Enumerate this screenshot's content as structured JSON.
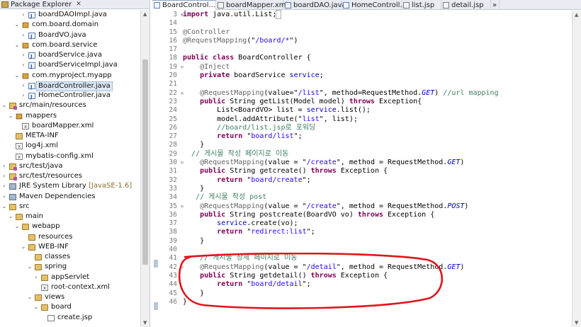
{
  "explorer": {
    "title": "Package Explorer",
    "close": "✕",
    "items": [
      {
        "label": "boardDAOImpl.java",
        "icon": "java-file-icon",
        "indent": 4,
        "twisty": ">"
      },
      {
        "label": "com.board.domain",
        "icon": "package-icon",
        "indent": 3,
        "twisty": "v"
      },
      {
        "label": "BoardVO.java",
        "icon": "java-file-icon",
        "indent": 4,
        "twisty": ">"
      },
      {
        "label": "com.board.service",
        "icon": "package-icon",
        "indent": 3,
        "twisty": "v"
      },
      {
        "label": "boardService.java",
        "icon": "java-file-icon",
        "indent": 4,
        "twisty": ">"
      },
      {
        "label": "boardServiceImpl.java",
        "icon": "java-file-icon",
        "indent": 4,
        "twisty": ">"
      },
      {
        "label": "com.myproject.myapp",
        "icon": "package-icon",
        "indent": 3,
        "twisty": "v"
      },
      {
        "label": "BoardController.java",
        "icon": "java-file-icon",
        "indent": 4,
        "twisty": ">",
        "selected": true
      },
      {
        "label": "HomeController.java",
        "icon": "java-file-icon",
        "indent": 4,
        "twisty": ">"
      },
      {
        "label": "src/main/resources",
        "icon": "source-folder-icon",
        "indent": 1,
        "twisty": "v"
      },
      {
        "label": "mappers",
        "icon": "package-icon",
        "indent": 2,
        "twisty": "v"
      },
      {
        "label": "boardMapper.xml",
        "icon": "xml-file-icon",
        "indent": 3,
        "twisty": ""
      },
      {
        "label": "META-INF",
        "icon": "folder-icon",
        "indent": 2,
        "twisty": ""
      },
      {
        "label": "log4j.xml",
        "icon": "xml-file-icon",
        "indent": 2,
        "twisty": ""
      },
      {
        "label": "mybatis-config.xml",
        "icon": "xml-file-icon",
        "indent": 2,
        "twisty": ""
      },
      {
        "label": "src/test/java",
        "icon": "source-folder-icon",
        "indent": 1,
        "twisty": ">"
      },
      {
        "label": "src/test/resources",
        "icon": "source-folder-icon",
        "indent": 1,
        "twisty": ">"
      },
      {
        "label": "JRE System Library",
        "suffix": " [JavaSE-1.6]",
        "icon": "library-icon",
        "indent": 1,
        "twisty": ">"
      },
      {
        "label": "Maven Dependencies",
        "icon": "library-icon",
        "indent": 1,
        "twisty": ">"
      },
      {
        "label": "src",
        "icon": "folder-icon",
        "indent": 1,
        "twisty": "v"
      },
      {
        "label": "main",
        "icon": "folder-icon",
        "indent": 2,
        "twisty": "v"
      },
      {
        "label": "webapp",
        "icon": "folder-icon",
        "indent": 3,
        "twisty": "v"
      },
      {
        "label": "resources",
        "icon": "folder-icon",
        "indent": 4,
        "twisty": ""
      },
      {
        "label": "WEB-INF",
        "icon": "folder-icon",
        "indent": 4,
        "twisty": "v"
      },
      {
        "label": "classes",
        "icon": "folder-icon",
        "indent": 5,
        "twisty": ""
      },
      {
        "label": "spring",
        "icon": "folder-icon",
        "indent": 5,
        "twisty": "v"
      },
      {
        "label": "appServlet",
        "icon": "folder-icon",
        "indent": 6,
        "twisty": ">"
      },
      {
        "label": "root-context.xml",
        "icon": "xml-file-icon",
        "indent": 6,
        "twisty": ""
      },
      {
        "label": "views",
        "icon": "folder-icon",
        "indent": 5,
        "twisty": "v"
      },
      {
        "label": "board",
        "icon": "folder-icon",
        "indent": 6,
        "twisty": "v"
      },
      {
        "label": "create.jsp",
        "icon": "jsp-file-icon",
        "indent": 7,
        "twisty": ""
      }
    ]
  },
  "editor": {
    "tabs": [
      {
        "label": "BoardControl...",
        "icon": "java-file-icon",
        "active": true,
        "close": "✕"
      },
      {
        "label": "boardMapper.xml",
        "icon": "xml-file-icon",
        "active": false
      },
      {
        "label": "boardDAO.java",
        "icon": "java-file-icon",
        "active": false
      },
      {
        "label": "HomeControll...",
        "icon": "java-file-icon",
        "active": false
      },
      {
        "label": "list.jsp",
        "icon": "jsp-file-icon",
        "active": false
      },
      {
        "label": "detail.jsp",
        "icon": "jsp-file-icon",
        "active": false
      },
      {
        "label": "»",
        "icon": "",
        "active": false
      }
    ],
    "lines": [
      {
        "n": "3",
        "fold": "⊕",
        "parts": [
          [
            "kw",
            "import"
          ],
          [
            "",
            "&nbsp;java.util.List;"
          ],
          [
            "bx",
            "&nbsp;"
          ]
        ]
      },
      {
        "n": "14",
        "parts": []
      },
      {
        "n": "15",
        "parts": [
          [
            "an",
            "@Controller"
          ]
        ]
      },
      {
        "n": "16",
        "parts": [
          [
            "an",
            "@RequestMapping"
          ],
          [
            "",
            "(\""
          ],
          [
            "st",
            "/board/*"
          ],
          [
            "",
            "\")"
          ]
        ]
      },
      {
        "n": "17",
        "parts": []
      },
      {
        "n": "18",
        "parts": [
          [
            "kw",
            "public"
          ],
          [
            "",
            "&nbsp;"
          ],
          [
            "kw",
            "class"
          ],
          [
            "",
            "&nbsp;BoardController&nbsp;{"
          ]
        ]
      },
      {
        "n": "19",
        "fold": "⊖",
        "parts": [
          [
            "",
            "&nbsp;&nbsp;&nbsp;&nbsp;"
          ],
          [
            "an",
            "@Inject"
          ]
        ]
      },
      {
        "n": "20",
        "parts": [
          [
            "",
            "&nbsp;&nbsp;&nbsp;&nbsp;"
          ],
          [
            "kw",
            "private"
          ],
          [
            "",
            "&nbsp;boardService&nbsp;"
          ],
          [
            "fd",
            "service"
          ],
          [
            "",
            ";"
          ]
        ]
      },
      {
        "n": "21",
        "parts": []
      },
      {
        "n": "22",
        "fold": "⊖",
        "parts": [
          [
            "",
            "&nbsp;&nbsp;&nbsp;&nbsp;"
          ],
          [
            "an",
            "@RequestMapping"
          ],
          [
            "",
            "(value=\""
          ],
          [
            "st",
            "/list"
          ],
          [
            "",
            "\",&nbsp;method=RequestMethod."
          ],
          [
            "fd it",
            "GET"
          ],
          [
            "",
            ")&nbsp;"
          ],
          [
            "cm",
            "//url&nbsp;mapping"
          ]
        ]
      },
      {
        "n": "23",
        "parts": [
          [
            "",
            "&nbsp;&nbsp;&nbsp;&nbsp;"
          ],
          [
            "kw",
            "public"
          ],
          [
            "",
            "&nbsp;String&nbsp;getList(Model&nbsp;model)&nbsp;"
          ],
          [
            "kw",
            "throws"
          ],
          [
            "",
            "&nbsp;Exception{"
          ]
        ]
      },
      {
        "n": "24",
        "parts": [
          [
            "",
            "&nbsp;&nbsp;&nbsp;&nbsp;&nbsp;&nbsp;&nbsp;&nbsp;List&lt;BoardVO&gt;&nbsp;list&nbsp;=&nbsp;"
          ],
          [
            "fd",
            "service"
          ],
          [
            "",
            ".list();"
          ]
        ]
      },
      {
        "n": "25",
        "parts": [
          [
            "",
            "&nbsp;&nbsp;&nbsp;&nbsp;&nbsp;&nbsp;&nbsp;&nbsp;model.addAttribute(\""
          ],
          [
            "st",
            "list"
          ],
          [
            "",
            "\",&nbsp;list);"
          ]
        ]
      },
      {
        "n": "26",
        "parts": [
          [
            "",
            "&nbsp;&nbsp;&nbsp;&nbsp;&nbsp;&nbsp;&nbsp;&nbsp;"
          ],
          [
            "cm",
            "//board/list.jsp로&nbsp;포워딩"
          ]
        ]
      },
      {
        "n": "27",
        "parts": [
          [
            "",
            "&nbsp;&nbsp;&nbsp;&nbsp;&nbsp;&nbsp;&nbsp;&nbsp;"
          ],
          [
            "kw",
            "return"
          ],
          [
            "",
            "&nbsp;\""
          ],
          [
            "st",
            "board/list"
          ],
          [
            "",
            "\";"
          ]
        ]
      },
      {
        "n": "28",
        "parts": [
          [
            "",
            "&nbsp;&nbsp;&nbsp;&nbsp;}"
          ]
        ]
      },
      {
        "n": "29",
        "parts": [
          [
            "",
            "&nbsp;&nbsp;"
          ],
          [
            "cm",
            "//&nbsp;게시물&nbsp;작성&nbsp;페이지로&nbsp;이동"
          ]
        ]
      },
      {
        "n": "30",
        "fold": "⊖",
        "parts": [
          [
            "",
            "&nbsp;&nbsp;&nbsp;&nbsp;"
          ],
          [
            "an",
            "@RequestMapping"
          ],
          [
            "",
            "(value&nbsp;=&nbsp;\""
          ],
          [
            "st",
            "/create"
          ],
          [
            "",
            "\",&nbsp;method&nbsp;=&nbsp;RequestMethod."
          ],
          [
            "fd it",
            "GET"
          ],
          [
            "",
            ")"
          ]
        ]
      },
      {
        "n": "31",
        "parts": [
          [
            "",
            "&nbsp;&nbsp;&nbsp;&nbsp;"
          ],
          [
            "kw",
            "public"
          ],
          [
            "",
            "&nbsp;String&nbsp;getcreate()&nbsp;"
          ],
          [
            "kw",
            "throws"
          ],
          [
            "",
            "&nbsp;Exception&nbsp;{"
          ]
        ]
      },
      {
        "n": "32",
        "parts": [
          [
            "",
            "&nbsp;&nbsp;&nbsp;&nbsp;&nbsp;&nbsp;&nbsp;&nbsp;"
          ],
          [
            "kw",
            "return"
          ],
          [
            "",
            "&nbsp;\""
          ],
          [
            "st",
            "board/create"
          ],
          [
            "",
            "\";"
          ]
        ]
      },
      {
        "n": "33",
        "parts": [
          [
            "",
            "&nbsp;&nbsp;&nbsp;&nbsp;}"
          ]
        ]
      },
      {
        "n": "34",
        "parts": [
          [
            "",
            "&nbsp;&nbsp;&nbsp;"
          ],
          [
            "cm",
            "//&nbsp;게시물&nbsp;작성&nbsp;post"
          ]
        ]
      },
      {
        "n": "35",
        "fold": "⊖",
        "parts": [
          [
            "",
            "&nbsp;&nbsp;&nbsp;&nbsp;"
          ],
          [
            "an",
            "@RequestMapping"
          ],
          [
            "",
            "(value&nbsp;=&nbsp;\""
          ],
          [
            "st",
            "/create"
          ],
          [
            "",
            "\",&nbsp;method&nbsp;=&nbsp;RequestMethod."
          ],
          [
            "fd it",
            "POST"
          ],
          [
            "",
            ")"
          ]
        ]
      },
      {
        "n": "36",
        "parts": [
          [
            "",
            "&nbsp;&nbsp;&nbsp;&nbsp;"
          ],
          [
            "kw",
            "public"
          ],
          [
            "",
            "&nbsp;String&nbsp;postcreate(BoardVO&nbsp;vo)&nbsp;"
          ],
          [
            "kw",
            "throws"
          ],
          [
            "",
            "&nbsp;Exception&nbsp;{"
          ]
        ]
      },
      {
        "n": "37",
        "parts": [
          [
            "",
            "&nbsp;&nbsp;&nbsp;&nbsp;&nbsp;&nbsp;&nbsp;&nbsp;"
          ],
          [
            "fd",
            "service"
          ],
          [
            "",
            ".create(vo);"
          ]
        ]
      },
      {
        "n": "38",
        "parts": [
          [
            "",
            "&nbsp;&nbsp;&nbsp;&nbsp;&nbsp;&nbsp;&nbsp;&nbsp;"
          ],
          [
            "kw",
            "return"
          ],
          [
            "",
            "&nbsp;\""
          ],
          [
            "st",
            "redirect:list"
          ],
          [
            "",
            "\";"
          ]
        ]
      },
      {
        "n": "39",
        "parts": [
          [
            "",
            "&nbsp;&nbsp;&nbsp;&nbsp;}"
          ]
        ]
      },
      {
        "n": "40",
        "parts": []
      },
      {
        "n": "41",
        "parts": [
          [
            "",
            "&nbsp;&nbsp;&nbsp;&nbsp;"
          ],
          [
            "cm",
            "//&nbsp;게시물&nbsp;상세&nbsp;페이지로&nbsp;이동"
          ]
        ]
      },
      {
        "n": "42",
        "fold": "⊖",
        "parts": [
          [
            "",
            "&nbsp;&nbsp;&nbsp;&nbsp;"
          ],
          [
            "an",
            "@RequestMapping"
          ],
          [
            "",
            "(value&nbsp;=&nbsp;\""
          ],
          [
            "st",
            "/detail"
          ],
          [
            "",
            "\",&nbsp;method&nbsp;=&nbsp;RequestMethod."
          ],
          [
            "fd it",
            "GET"
          ],
          [
            "",
            ")"
          ]
        ]
      },
      {
        "n": "43",
        "parts": [
          [
            "",
            "&nbsp;&nbsp;&nbsp;&nbsp;"
          ],
          [
            "kw",
            "public"
          ],
          [
            "",
            "&nbsp;String&nbsp;getdetail()&nbsp;"
          ],
          [
            "kw",
            "throws"
          ],
          [
            "",
            "&nbsp;Exception&nbsp;{"
          ]
        ]
      },
      {
        "n": "44",
        "parts": [
          [
            "",
            "&nbsp;&nbsp;&nbsp;&nbsp;&nbsp;&nbsp;&nbsp;&nbsp;"
          ],
          [
            "kw",
            "return"
          ],
          [
            "",
            "&nbsp;\""
          ],
          [
            "st",
            "board/detail"
          ],
          [
            "",
            "\";"
          ]
        ]
      },
      {
        "n": "45",
        "parts": [
          [
            "",
            "&nbsp;&nbsp;&nbsp;&nbsp;}"
          ]
        ]
      },
      {
        "n": "46",
        "parts": [
          [
            "",
            "}"
          ]
        ]
      }
    ]
  },
  "colors": {
    "keyword": "#7f0055",
    "annotation": "#646464",
    "string": "#2a00ff",
    "comment": "#3f7f5f",
    "field": "#0000c0",
    "highlight_ellipse": "#e0141e"
  }
}
